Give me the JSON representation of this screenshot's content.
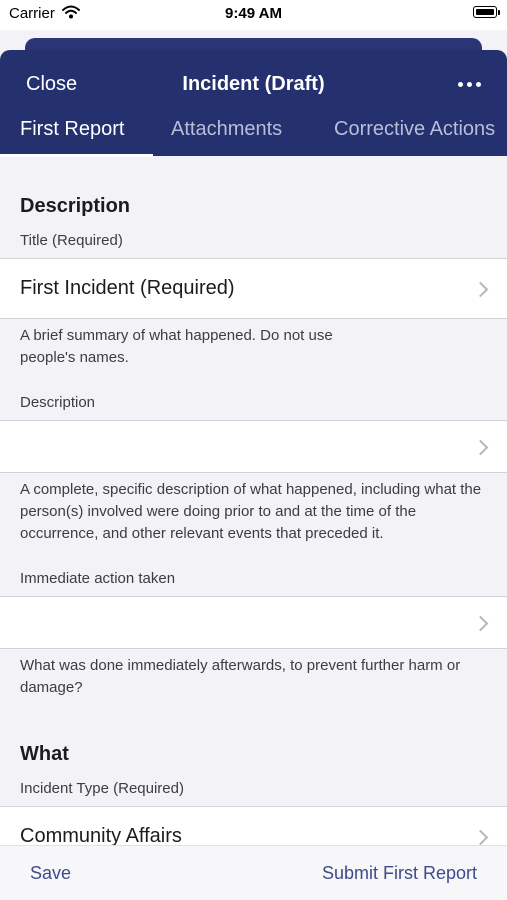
{
  "status_bar": {
    "carrier": "Carrier",
    "time": "9:49 AM"
  },
  "nav": {
    "close": "Close",
    "title": "Incident (Draft)",
    "more_icon": "ellipsis-icon"
  },
  "tabs": [
    {
      "label": "First Report",
      "active": true
    },
    {
      "label": "Attachments",
      "active": false
    },
    {
      "label": "Corrective Actions",
      "active": false
    }
  ],
  "sections": {
    "description": {
      "header": "Description",
      "title_label": "Title (Required)",
      "title_value": "First Incident (Required)",
      "title_hint": "A brief summary of what happened. Do not use people's names.",
      "description_label": "Description",
      "description_value": "",
      "description_hint": "A complete, specific description of what happened, including what the person(s) involved were doing prior to and at the time of the occurrence, and other relevant events that preceded it.",
      "action_label": "Immediate action taken",
      "action_value": "",
      "action_hint": "What was done immediately afterwards, to prevent further harm or damage?"
    },
    "what": {
      "header": "What",
      "type_label": "Incident Type (Required)",
      "type_value": "Community Affairs"
    }
  },
  "bottom_bar": {
    "save": "Save",
    "submit": "Submit First Report"
  },
  "colors": {
    "header_bg": "#25306e",
    "accent": "#3f4a8c",
    "background": "#f2f2f7"
  }
}
